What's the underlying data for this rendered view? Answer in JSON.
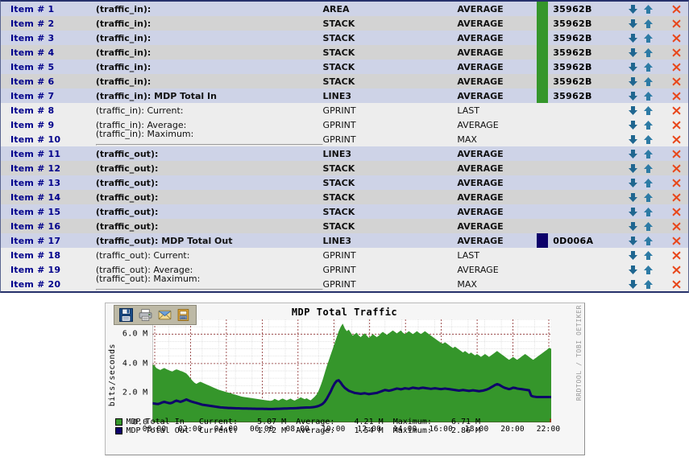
{
  "colors": {
    "traffic_in": "#35962B",
    "traffic_out": "#0D006A",
    "item_number": "#00008b",
    "hr_tag": "#cc0000",
    "arrow_down": "#1f6690",
    "arrow_up": "#2d7ba5",
    "delete_x": "#e8481c"
  },
  "items_table": {
    "rows": [
      {
        "num": "Item # 1",
        "desc": "(traffic_in):",
        "bold": true,
        "type": "AREA",
        "cf": "AVERAGE",
        "color": "35962B",
        "swatch": "#35962B",
        "shade": "alt-a"
      },
      {
        "num": "Item # 2",
        "desc": "(traffic_in):",
        "bold": true,
        "type": "STACK",
        "cf": "AVERAGE",
        "color": "35962B",
        "swatch": "#35962B",
        "shade": "alt-b"
      },
      {
        "num": "Item # 3",
        "desc": "(traffic_in):",
        "bold": true,
        "type": "STACK",
        "cf": "AVERAGE",
        "color": "35962B",
        "swatch": "#35962B",
        "shade": "alt-a"
      },
      {
        "num": "Item # 4",
        "desc": "(traffic_in):",
        "bold": true,
        "type": "STACK",
        "cf": "AVERAGE",
        "color": "35962B",
        "swatch": "#35962B",
        "shade": "alt-b"
      },
      {
        "num": "Item # 5",
        "desc": "(traffic_in):",
        "bold": true,
        "type": "STACK",
        "cf": "AVERAGE",
        "color": "35962B",
        "swatch": "#35962B",
        "shade": "alt-a"
      },
      {
        "num": "Item # 6",
        "desc": "(traffic_in):",
        "bold": true,
        "type": "STACK",
        "cf": "AVERAGE",
        "color": "35962B",
        "swatch": "#35962B",
        "shade": "alt-b"
      },
      {
        "num": "Item # 7",
        "desc": "(traffic_in): MDP Total In",
        "bold": true,
        "type": "LINE3",
        "cf": "AVERAGE",
        "color": "35962B",
        "swatch": "#35962B",
        "shade": "alt-a"
      },
      {
        "num": "Item # 8",
        "desc": "(traffic_in): Current:",
        "bold": false,
        "type": "GPRINT",
        "cf": "LAST",
        "color": "",
        "swatch": "",
        "shade": "plain"
      },
      {
        "num": "Item # 9",
        "desc": "(traffic_in): Average:",
        "bold": false,
        "type": "GPRINT",
        "cf": "AVERAGE",
        "color": "",
        "swatch": "",
        "shade": "plain"
      },
      {
        "num": "Item # 10",
        "desc": "(traffic_in): Maximum:",
        "hr": "<HR>",
        "bold": false,
        "type": "GPRINT",
        "cf": "MAX",
        "color": "",
        "swatch": "",
        "shade": "plain"
      },
      {
        "num": "Item # 11",
        "desc": "(traffic_out):",
        "bold": true,
        "type": "LINE3",
        "cf": "AVERAGE",
        "color": "",
        "swatch": "",
        "shade": "alt-a"
      },
      {
        "num": "Item # 12",
        "desc": "(traffic_out):",
        "bold": true,
        "type": "STACK",
        "cf": "AVERAGE",
        "color": "",
        "swatch": "",
        "shade": "alt-b"
      },
      {
        "num": "Item # 13",
        "desc": "(traffic_out):",
        "bold": true,
        "type": "STACK",
        "cf": "AVERAGE",
        "color": "",
        "swatch": "",
        "shade": "alt-a"
      },
      {
        "num": "Item # 14",
        "desc": "(traffic_out):",
        "bold": true,
        "type": "STACK",
        "cf": "AVERAGE",
        "color": "",
        "swatch": "",
        "shade": "alt-b"
      },
      {
        "num": "Item # 15",
        "desc": "(traffic_out):",
        "bold": true,
        "type": "STACK",
        "cf": "AVERAGE",
        "color": "",
        "swatch": "",
        "shade": "alt-a"
      },
      {
        "num": "Item # 16",
        "desc": "(traffic_out):",
        "bold": true,
        "type": "STACK",
        "cf": "AVERAGE",
        "color": "",
        "swatch": "",
        "shade": "alt-b"
      },
      {
        "num": "Item # 17",
        "desc": "(traffic_out): MDP Total Out",
        "bold": true,
        "type": "LINE3",
        "cf": "AVERAGE",
        "color": "0D006A",
        "swatch": "#0D006A",
        "shade": "alt-a"
      },
      {
        "num": "Item # 18",
        "desc": "(traffic_out): Current:",
        "bold": false,
        "type": "GPRINT",
        "cf": "LAST",
        "color": "",
        "swatch": "",
        "shade": "plain"
      },
      {
        "num": "Item # 19",
        "desc": "(traffic_out): Average:",
        "bold": false,
        "type": "GPRINT",
        "cf": "AVERAGE",
        "color": "",
        "swatch": "",
        "shade": "plain"
      },
      {
        "num": "Item # 20",
        "desc": "(traffic_out): Maximum:",
        "hr": "<HR>",
        "bold": false,
        "type": "GPRINT",
        "cf": "MAX",
        "color": "",
        "swatch": "",
        "shade": "plain"
      }
    ]
  },
  "graph": {
    "toolbar": [
      {
        "name": "save-icon",
        "label": "Save"
      },
      {
        "name": "print-icon",
        "label": "Print"
      },
      {
        "name": "mail-icon",
        "label": "Mail"
      },
      {
        "name": "copy-icon",
        "label": "Copy"
      }
    ],
    "watermark": "RRDTOOL / TOBI OETIKER",
    "legend": [
      {
        "swatch": "#35962B",
        "name": "MDP Total In ",
        "current_label": "Current:",
        "current": "5.07 M",
        "average_label": "Average:",
        "average": "4.21 M",
        "maximum_label": "Maximum:",
        "maximum": "6.71 M"
      },
      {
        "swatch": "#0D006A",
        "name": "MDP Total Out",
        "current_label": "Current:",
        "current": "1.72 M",
        "average_label": "Average:",
        "average": "1.54 M",
        "maximum_label": "Maximum:",
        "maximum": "2.86 M"
      }
    ]
  },
  "chart_data": {
    "type": "area",
    "title": "MDP Total Traffic",
    "xlabel": "",
    "ylabel": "bits/seconds",
    "ylim": [
      0,
      7000000
    ],
    "yticks": [
      "0.0",
      "2.0 M",
      "4.0 M",
      "6.0 M"
    ],
    "ytick_values": [
      0,
      2000000,
      4000000,
      6000000
    ],
    "xticks": [
      "00:00",
      "02:00",
      "04:00",
      "06:00",
      "08:00",
      "10:00",
      "12:00",
      "14:00",
      "16:00",
      "18:00",
      "20:00",
      "22:00"
    ],
    "grid": true,
    "legend_position": "bottom",
    "series": [
      {
        "name": "MDP Total In",
        "color": "#35962B",
        "style": "area",
        "current": 5070000,
        "average": 4210000,
        "maximum": 6710000,
        "values": [
          3950000,
          3880000,
          3700000,
          3620000,
          3560000,
          3640000,
          3700000,
          3620000,
          3560000,
          3500000,
          3460000,
          3540000,
          3600000,
          3560000,
          3500000,
          3460000,
          3400000,
          3320000,
          3180000,
          3000000,
          2840000,
          2700000,
          2620000,
          2700000,
          2760000,
          2700000,
          2640000,
          2580000,
          2520000,
          2460000,
          2400000,
          2340000,
          2280000,
          2220000,
          2180000,
          2140000,
          2100000,
          2060000,
          2020000,
          1980000,
          1940000,
          1900000,
          1860000,
          1820000,
          1780000,
          1740000,
          1720000,
          1700000,
          1680000,
          1660000,
          1640000,
          1620000,
          1600000,
          1580000,
          1560000,
          1540000,
          1520000,
          1500000,
          1480000,
          1460000,
          1500000,
          1600000,
          1540000,
          1480000,
          1560000,
          1620000,
          1560000,
          1500000,
          1560000,
          1620000,
          1540000,
          1480000,
          1560000,
          1620000,
          1700000,
          1640000,
          1580000,
          1640000,
          1560000,
          1500000,
          1620000,
          1740000,
          1900000,
          2160000,
          2500000,
          2900000,
          3350000,
          3800000,
          4200000,
          4600000,
          5000000,
          5400000,
          5800000,
          6200000,
          6500000,
          6710000,
          6400000,
          6200000,
          6300000,
          6100000,
          5900000,
          6000000,
          6100000,
          5900000,
          5800000,
          5950000,
          6050000,
          5900000,
          5750000,
          5850000,
          6000000,
          5900000,
          5800000,
          5900000,
          6050000,
          6150000,
          6050000,
          5950000,
          6050000,
          6150000,
          6250000,
          6150000,
          6050000,
          6150000,
          6250000,
          6100000,
          6000000,
          6100000,
          6200000,
          6100000,
          6000000,
          6100000,
          6200000,
          6100000,
          6000000,
          6100000,
          6200000,
          6100000,
          6000000,
          5900000,
          5800000,
          5700000,
          5600000,
          5500000,
          5400000,
          5350000,
          5450000,
          5350000,
          5250000,
          5150000,
          5050000,
          5150000,
          5050000,
          4950000,
          4850000,
          4750000,
          4850000,
          4750000,
          4650000,
          4750000,
          4650000,
          4550000,
          4650000,
          4550000,
          4450000,
          4550000,
          4650000,
          4550000,
          4450000,
          4550000,
          4650000,
          4750000,
          4850000,
          4750000,
          4650000,
          4550000,
          4450000,
          4350000,
          4250000,
          4350000,
          4450000,
          4350000,
          4250000,
          4350000,
          4450000,
          4550000,
          4650000,
          4550000,
          4450000,
          4350000,
          4250000,
          4350000,
          4450000,
          4550000,
          4650000,
          4750000,
          4850000,
          4950000,
          5070000,
          5000000
        ]
      },
      {
        "name": "MDP Total Out",
        "color": "#0D006A",
        "style": "line",
        "current": 1720000,
        "average": 1540000,
        "maximum": 2860000,
        "values": [
          1300000,
          1280000,
          1260000,
          1250000,
          1300000,
          1360000,
          1400000,
          1360000,
          1320000,
          1300000,
          1340000,
          1420000,
          1480000,
          1440000,
          1400000,
          1440000,
          1500000,
          1560000,
          1500000,
          1440000,
          1400000,
          1360000,
          1320000,
          1280000,
          1240000,
          1200000,
          1180000,
          1160000,
          1140000,
          1120000,
          1100000,
          1080000,
          1060000,
          1040000,
          1020000,
          1010000,
          1000000,
          990000,
          980000,
          975000,
          970000,
          965000,
          960000,
          955000,
          950000,
          945000,
          940000,
          940000,
          935000,
          935000,
          930000,
          930000,
          925000,
          925000,
          920000,
          920000,
          915000,
          915000,
          910000,
          910000,
          910000,
          915000,
          920000,
          925000,
          930000,
          935000,
          940000,
          945000,
          950000,
          955000,
          960000,
          965000,
          970000,
          980000,
          990000,
          1000000,
          1005000,
          1010000,
          1015000,
          1020000,
          1030000,
          1050000,
          1080000,
          1120000,
          1180000,
          1260000,
          1400000,
          1600000,
          1850000,
          2100000,
          2400000,
          2650000,
          2820000,
          2860000,
          2700000,
          2500000,
          2350000,
          2250000,
          2150000,
          2100000,
          2050000,
          2000000,
          1980000,
          1960000,
          1940000,
          1960000,
          1980000,
          1950000,
          1920000,
          1940000,
          1960000,
          1980000,
          2000000,
          2050000,
          2100000,
          2150000,
          2200000,
          2180000,
          2150000,
          2180000,
          2220000,
          2260000,
          2300000,
          2280000,
          2250000,
          2280000,
          2320000,
          2300000,
          2280000,
          2320000,
          2360000,
          2340000,
          2320000,
          2300000,
          2340000,
          2360000,
          2340000,
          2320000,
          2300000,
          2280000,
          2300000,
          2320000,
          2300000,
          2280000,
          2260000,
          2280000,
          2300000,
          2280000,
          2260000,
          2240000,
          2220000,
          2200000,
          2180000,
          2160000,
          2180000,
          2200000,
          2180000,
          2160000,
          2140000,
          2160000,
          2180000,
          2160000,
          2140000,
          2120000,
          2140000,
          2160000,
          2200000,
          2240000,
          2300000,
          2380000,
          2460000,
          2540000,
          2600000,
          2560000,
          2480000,
          2400000,
          2340000,
          2300000,
          2260000,
          2300000,
          2360000,
          2340000,
          2300000,
          2280000,
          2260000,
          2240000,
          2220000,
          2200000,
          2180000,
          1820000,
          1760000,
          1740000,
          1720000,
          1720000,
          1720000,
          1720000,
          1720000,
          1720000,
          1720000,
          1720000
        ]
      }
    ]
  }
}
